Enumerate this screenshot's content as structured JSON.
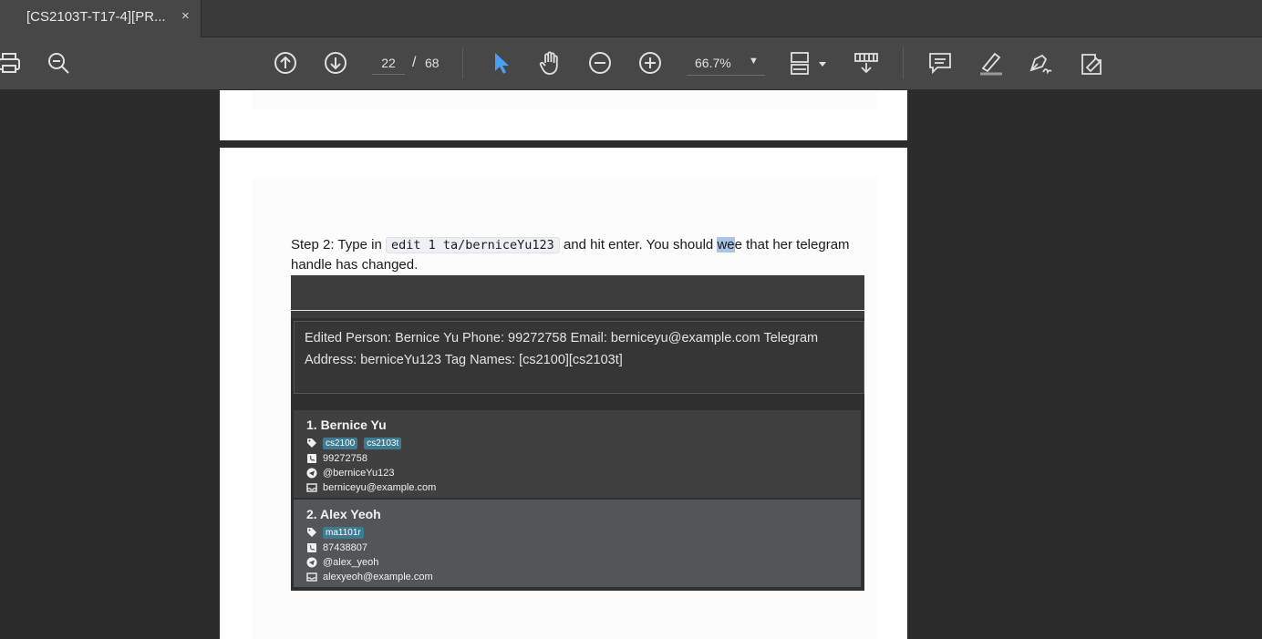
{
  "tab": {
    "title": "[CS2103T-T17-4][PR...",
    "close": "×"
  },
  "toolbar": {
    "page_current": "22",
    "page_sep": "/",
    "page_total": "68",
    "zoom": "66.7%",
    "zoom_caret": "▼"
  },
  "doc": {
    "step_prefix": "Step 2: Type in ",
    "command": "edit 1 ta/berniceYu123",
    "step_mid": " and hit enter. You should ",
    "step_hl": "we",
    "step_end": "e that her telegram handle has changed."
  },
  "screenshot": {
    "result_line1": "Edited Person: Bernice Yu Phone: 99272758 Email: berniceyu@example.com Telegram",
    "result_line2": "Address: berniceYu123 Tag Names: [cs2100][cs2103t]",
    "persons": [
      {
        "index_name": "1.  Bernice Yu",
        "tags": [
          "cs2100",
          "cs2103t"
        ],
        "phone": "99272758",
        "telegram": "@berniceYu123",
        "email": "berniceyu@example.com"
      },
      {
        "index_name": "2.  Alex Yeoh",
        "tags": [
          "ma1101r"
        ],
        "phone": "87438807",
        "telegram": "@alex_yeoh",
        "email": "alexyeoh@example.com"
      }
    ]
  },
  "colors": {
    "toolbar": "#474747",
    "viewer": "#2b2b2b",
    "select_tool": "#4a9ff5",
    "tag": "#3e7b91"
  },
  "icons": [
    "print-icon",
    "zoom-out-magnifier-icon",
    "prev-page-icon",
    "next-page-icon",
    "select-tool-icon",
    "hand-tool-icon",
    "zoom-out-icon",
    "zoom-in-icon",
    "page-fit-icon",
    "read-mode-icon",
    "comment-icon",
    "highlight-icon",
    "sign-icon",
    "fill-sign-icon"
  ]
}
